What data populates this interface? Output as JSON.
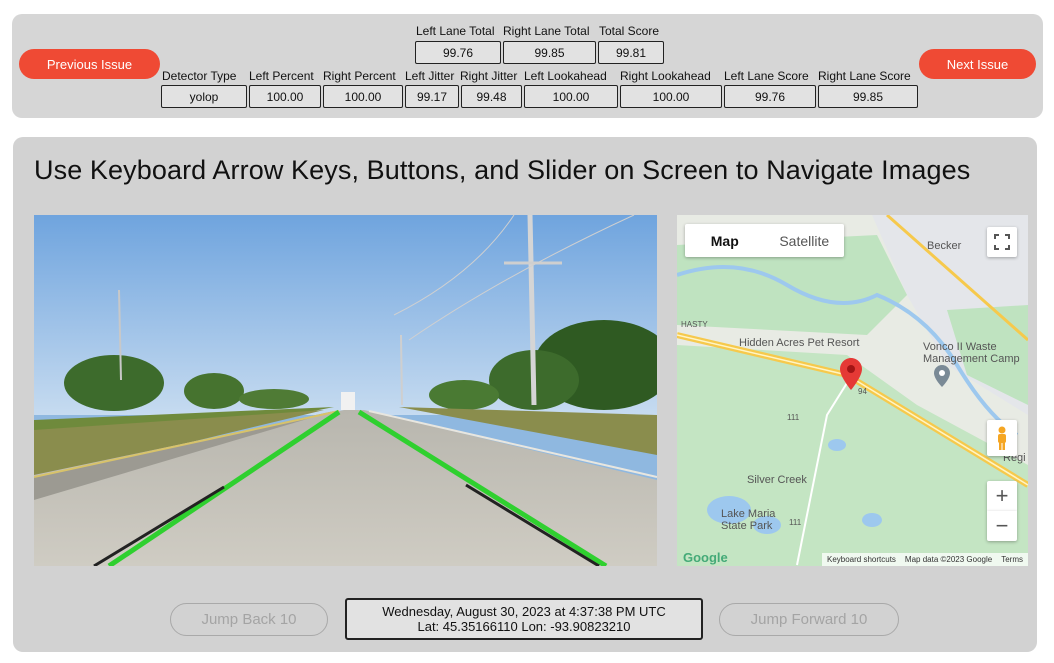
{
  "nav": {
    "previous_label": "Previous Issue",
    "next_label": "Next Issue"
  },
  "totals": {
    "headers": [
      "Left Lane Total",
      "Right Lane Total",
      "Total Score"
    ],
    "values": [
      "99.76",
      "99.85",
      "99.81"
    ]
  },
  "metrics": {
    "headers": [
      "Detector Type",
      "Left Percent",
      "Right Percent",
      "Left Jitter",
      "Right Jitter",
      "Left Lookahead",
      "Right Lookahead",
      "Left Lane Score",
      "Right Lane Score"
    ],
    "values": [
      "yolop",
      "100.00",
      "100.00",
      "99.17",
      "99.48",
      "100.00",
      "100.00",
      "99.76",
      "99.85"
    ]
  },
  "main": {
    "title": "Use Keyboard Arrow Keys, Buttons, and Slider on Screen to Navigate Images"
  },
  "map": {
    "tab_map": "Map",
    "tab_satellite": "Satellite",
    "labels": {
      "becker": "Becker",
      "hasty": "HASTY",
      "hidden_acres": "Hidden Acres Pet Resort",
      "vonco_1": "Vonco II Waste",
      "vonco_2": "Management Camp",
      "regio": "Regi",
      "silver_creek": "Silver Creek",
      "lake_maria_1": "Lake Maria",
      "lake_maria_2": "State Park",
      "route_94": "94",
      "route_111a": "111",
      "route_111b": "111",
      "google": "Google"
    },
    "footer": {
      "shortcuts": "Keyboard shortcuts",
      "mapdata": "Map data ©2023 Google",
      "terms": "Terms"
    },
    "zoom_in": "+",
    "zoom_out": "−",
    "icons": {
      "fullscreen": "fullscreen-icon",
      "pegman": "pegman-icon",
      "marker": "location-pin-icon"
    },
    "colors": {
      "land": "#e8ebe4",
      "green": "#bfe3c0",
      "water": "#9dc8ee",
      "highway": "#f6c94c",
      "marker": "#e53935"
    }
  },
  "controls": {
    "jump_back": "Jump Back 10",
    "jump_forward": "Jump Forward 10",
    "datetime": "Wednesday, August 30, 2023 at 4:37:38 PM UTC",
    "coords": "Lat: 45.35166110 Lon: -93.90823210"
  },
  "colors": {
    "accent": "#ef4a34",
    "lane_overlay": "#2fd02f",
    "panel": "#d6d6d6"
  }
}
